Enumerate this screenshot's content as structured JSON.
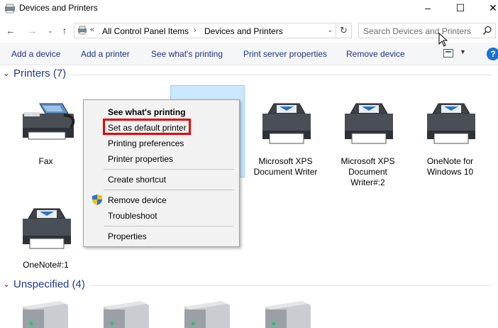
{
  "window": {
    "title": "Devices and Printers"
  },
  "nav": {
    "breadcrumb_prefix": "«",
    "breadcrumbs": [
      "All Control Panel Items",
      "Devices and Printers"
    ],
    "search_placeholder": "Search Devices and Printers"
  },
  "commands": [
    "Add a device",
    "Add a printer",
    "See what's printing",
    "Print server properties",
    "Remove device"
  ],
  "groups": {
    "printers": {
      "title": "Printers (7)"
    },
    "unspecified": {
      "title": "Unspecified (4)"
    }
  },
  "devices": [
    {
      "label": "Fax",
      "icon": "fax-icon"
    },
    {
      "label": "",
      "icon": "printer-icon",
      "selected": true
    },
    {
      "label": "Microsoft XPS Document Writer",
      "icon": "printer-icon"
    },
    {
      "label": "Microsoft XPS Document Writer#:2",
      "icon": "printer-icon"
    },
    {
      "label": "OneNote for Windows 10",
      "icon": "printer-icon"
    },
    {
      "label": "OneNote#:1",
      "icon": "printer-icon"
    }
  ],
  "context_menu": {
    "items": [
      {
        "label": "See what's printing",
        "bold": true
      },
      {
        "label": "Set as default printer",
        "highlighted": true
      },
      {
        "label": "Printing preferences"
      },
      {
        "label": "Printer properties"
      },
      {
        "label": "Create shortcut"
      },
      {
        "label": "Remove device",
        "icon": "shield-icon"
      },
      {
        "label": "Troubleshoot"
      },
      {
        "label": "Properties"
      }
    ]
  },
  "colors": {
    "accent": "#1e3a8a",
    "selection": "#cce8ff",
    "highlight_box": "#e60000",
    "help": "#1872d4"
  }
}
